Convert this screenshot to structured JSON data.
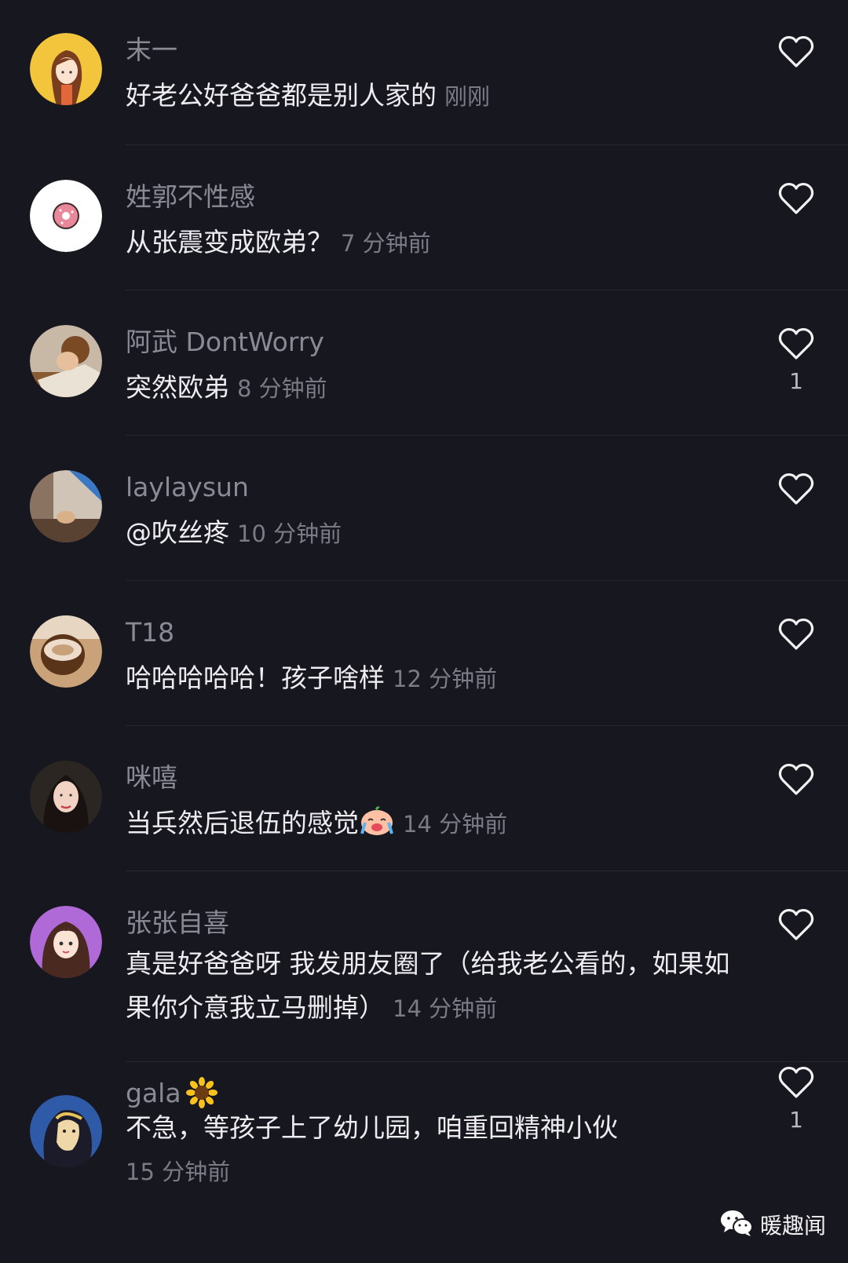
{
  "comments": [
    {
      "username": "末一",
      "text": "好老公好爸爸都是别人家的",
      "time": "刚刚",
      "likes": ""
    },
    {
      "username": "姓郭不性感",
      "text": "从张震变成欧弟？",
      "time": "7 分钟前",
      "likes": ""
    },
    {
      "username": "阿武 DontWorry",
      "text": "突然欧弟",
      "time": "8 分钟前",
      "likes": "1"
    },
    {
      "username": "laylaysun",
      "text": "@吹丝疼",
      "time": "10 分钟前",
      "likes": ""
    },
    {
      "username": "T18",
      "text": "哈哈哈哈哈！孩子啥样",
      "time": "12 分钟前",
      "likes": ""
    },
    {
      "username": "咪嘻",
      "text": "当兵然后退伍的感觉",
      "time": "14 分钟前",
      "likes": ""
    },
    {
      "username": "张张自喜",
      "text": "真是好爸爸呀  我发朋友圈了（给我老公看的，如果如果你介意我立马删掉）",
      "time": "14 分钟前",
      "likes": ""
    },
    {
      "username": "gala",
      "text": "不急，等孩子上了幼儿园，咱重回精神小伙",
      "time": "15 分钟前",
      "likes": "1"
    }
  ],
  "watermark": {
    "text": "暖趣闻",
    "icon": "wechat-icon"
  },
  "icons": {
    "like": "heart-outline-icon",
    "crying_emoji": "crying-face-emoji",
    "sunflower_emoji": "sunflower-emoji"
  },
  "colors": {
    "background": "#17171f",
    "username": "#8a8a94",
    "text": "#ececf1",
    "timestamp": "#7b7b85"
  }
}
